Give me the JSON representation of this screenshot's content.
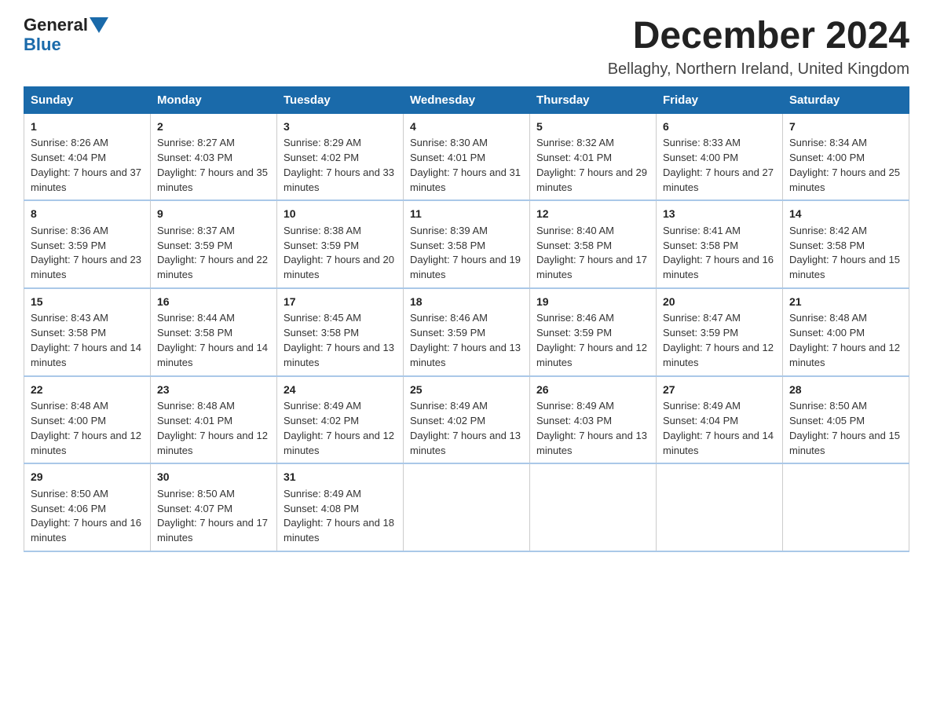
{
  "logo": {
    "general": "General",
    "blue": "Blue"
  },
  "header": {
    "title": "December 2024",
    "subtitle": "Bellaghy, Northern Ireland, United Kingdom"
  },
  "days_of_week": [
    "Sunday",
    "Monday",
    "Tuesday",
    "Wednesday",
    "Thursday",
    "Friday",
    "Saturday"
  ],
  "weeks": [
    [
      {
        "date": "1",
        "sunrise": "8:26 AM",
        "sunset": "4:04 PM",
        "daylight": "7 hours and 37 minutes."
      },
      {
        "date": "2",
        "sunrise": "8:27 AM",
        "sunset": "4:03 PM",
        "daylight": "7 hours and 35 minutes."
      },
      {
        "date": "3",
        "sunrise": "8:29 AM",
        "sunset": "4:02 PM",
        "daylight": "7 hours and 33 minutes."
      },
      {
        "date": "4",
        "sunrise": "8:30 AM",
        "sunset": "4:01 PM",
        "daylight": "7 hours and 31 minutes."
      },
      {
        "date": "5",
        "sunrise": "8:32 AM",
        "sunset": "4:01 PM",
        "daylight": "7 hours and 29 minutes."
      },
      {
        "date": "6",
        "sunrise": "8:33 AM",
        "sunset": "4:00 PM",
        "daylight": "7 hours and 27 minutes."
      },
      {
        "date": "7",
        "sunrise": "8:34 AM",
        "sunset": "4:00 PM",
        "daylight": "7 hours and 25 minutes."
      }
    ],
    [
      {
        "date": "8",
        "sunrise": "8:36 AM",
        "sunset": "3:59 PM",
        "daylight": "7 hours and 23 minutes."
      },
      {
        "date": "9",
        "sunrise": "8:37 AM",
        "sunset": "3:59 PM",
        "daylight": "7 hours and 22 minutes."
      },
      {
        "date": "10",
        "sunrise": "8:38 AM",
        "sunset": "3:59 PM",
        "daylight": "7 hours and 20 minutes."
      },
      {
        "date": "11",
        "sunrise": "8:39 AM",
        "sunset": "3:58 PM",
        "daylight": "7 hours and 19 minutes."
      },
      {
        "date": "12",
        "sunrise": "8:40 AM",
        "sunset": "3:58 PM",
        "daylight": "7 hours and 17 minutes."
      },
      {
        "date": "13",
        "sunrise": "8:41 AM",
        "sunset": "3:58 PM",
        "daylight": "7 hours and 16 minutes."
      },
      {
        "date": "14",
        "sunrise": "8:42 AM",
        "sunset": "3:58 PM",
        "daylight": "7 hours and 15 minutes."
      }
    ],
    [
      {
        "date": "15",
        "sunrise": "8:43 AM",
        "sunset": "3:58 PM",
        "daylight": "7 hours and 14 minutes."
      },
      {
        "date": "16",
        "sunrise": "8:44 AM",
        "sunset": "3:58 PM",
        "daylight": "7 hours and 14 minutes."
      },
      {
        "date": "17",
        "sunrise": "8:45 AM",
        "sunset": "3:58 PM",
        "daylight": "7 hours and 13 minutes."
      },
      {
        "date": "18",
        "sunrise": "8:46 AM",
        "sunset": "3:59 PM",
        "daylight": "7 hours and 13 minutes."
      },
      {
        "date": "19",
        "sunrise": "8:46 AM",
        "sunset": "3:59 PM",
        "daylight": "7 hours and 12 minutes."
      },
      {
        "date": "20",
        "sunrise": "8:47 AM",
        "sunset": "3:59 PM",
        "daylight": "7 hours and 12 minutes."
      },
      {
        "date": "21",
        "sunrise": "8:48 AM",
        "sunset": "4:00 PM",
        "daylight": "7 hours and 12 minutes."
      }
    ],
    [
      {
        "date": "22",
        "sunrise": "8:48 AM",
        "sunset": "4:00 PM",
        "daylight": "7 hours and 12 minutes."
      },
      {
        "date": "23",
        "sunrise": "8:48 AM",
        "sunset": "4:01 PM",
        "daylight": "7 hours and 12 minutes."
      },
      {
        "date": "24",
        "sunrise": "8:49 AM",
        "sunset": "4:02 PM",
        "daylight": "7 hours and 12 minutes."
      },
      {
        "date": "25",
        "sunrise": "8:49 AM",
        "sunset": "4:02 PM",
        "daylight": "7 hours and 13 minutes."
      },
      {
        "date": "26",
        "sunrise": "8:49 AM",
        "sunset": "4:03 PM",
        "daylight": "7 hours and 13 minutes."
      },
      {
        "date": "27",
        "sunrise": "8:49 AM",
        "sunset": "4:04 PM",
        "daylight": "7 hours and 14 minutes."
      },
      {
        "date": "28",
        "sunrise": "8:50 AM",
        "sunset": "4:05 PM",
        "daylight": "7 hours and 15 minutes."
      }
    ],
    [
      {
        "date": "29",
        "sunrise": "8:50 AM",
        "sunset": "4:06 PM",
        "daylight": "7 hours and 16 minutes."
      },
      {
        "date": "30",
        "sunrise": "8:50 AM",
        "sunset": "4:07 PM",
        "daylight": "7 hours and 17 minutes."
      },
      {
        "date": "31",
        "sunrise": "8:49 AM",
        "sunset": "4:08 PM",
        "daylight": "7 hours and 18 minutes."
      },
      null,
      null,
      null,
      null
    ]
  ],
  "labels": {
    "sunrise": "Sunrise:",
    "sunset": "Sunset:",
    "daylight": "Daylight:"
  },
  "accent_color": "#1a6aaa"
}
